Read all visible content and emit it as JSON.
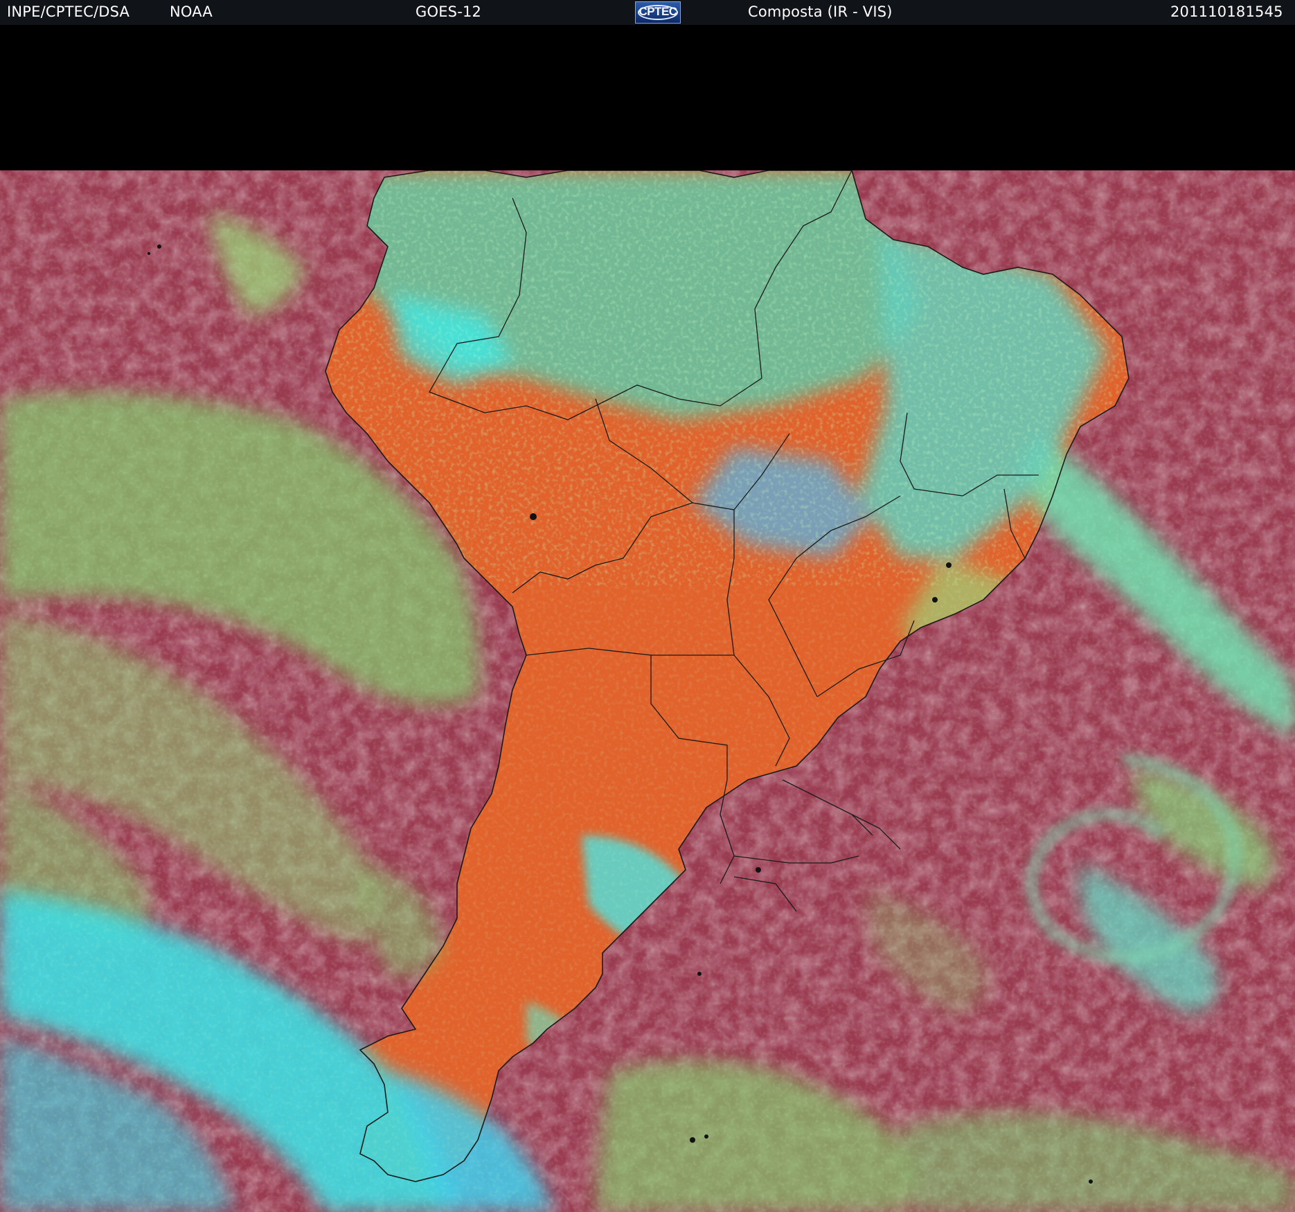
{
  "header": {
    "agency": "INPE/CPTEC/DSA",
    "source": "NOAA",
    "satellite": "GOES-12",
    "logo_text": "CPTEC",
    "product": "Composta (IR - VIS)",
    "timestamp": "201110181545"
  },
  "colors": {
    "ocean_clear": "#9b3b52",
    "land_clear": "#e2622c",
    "low_cloud": "#86d572",
    "high_cloud": "#3ef2ee",
    "mid_cloud": "#4da4e8",
    "header_bg": "#101317",
    "border_line": "#1a1a1a"
  },
  "icons": {
    "logo": "cptec-logo-icon"
  }
}
